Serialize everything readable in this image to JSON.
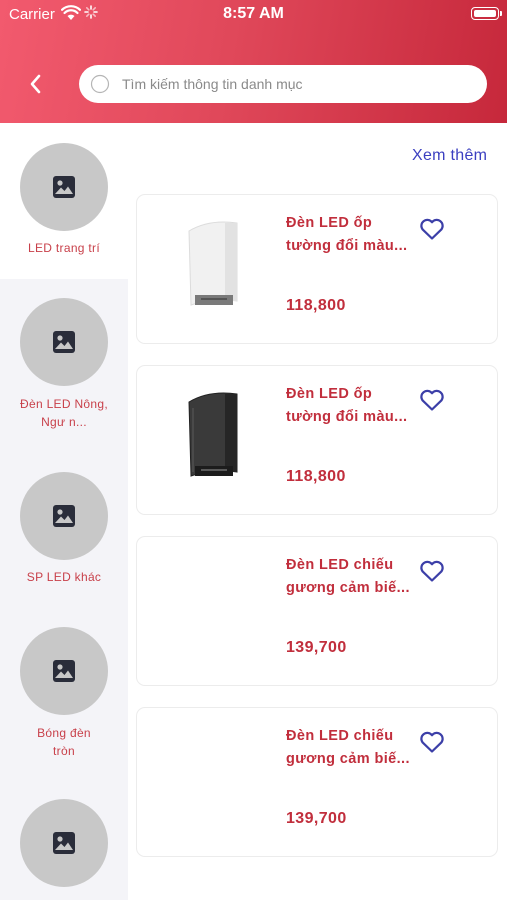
{
  "status_bar": {
    "carrier": "Carrier",
    "time": "8:57 AM"
  },
  "header": {
    "back_icon": "chevron-left-icon",
    "search": {
      "placeholder": "Tìm kiếm thông tin danh mục",
      "value": "",
      "icon": "search-icon"
    }
  },
  "colors": {
    "header_gradient_start": "#f25a6e",
    "header_gradient_end": "#c6283b",
    "accent_red": "#c12e3c",
    "link_blue": "#3b3fc0",
    "sidebar_bg": "#f4f4f8"
  },
  "sidebar": {
    "categories": [
      {
        "label": "LED trang trí",
        "icon": "image-placeholder-icon",
        "active": true
      },
      {
        "label": "Đèn LED Nông, Ngư n...",
        "icon": "image-placeholder-icon",
        "active": false
      },
      {
        "label": "SP LED khác",
        "icon": "image-placeholder-icon",
        "active": false
      },
      {
        "label": "Bóng đèn tròn",
        "icon": "image-placeholder-icon",
        "active": false
      },
      {
        "label": "",
        "icon": "image-placeholder-icon",
        "active": false
      }
    ]
  },
  "main": {
    "see_more": "Xem thêm",
    "products": [
      {
        "name_line1": "Đèn LED ốp",
        "name_line2": "tường đổi màu...",
        "price": "118,800",
        "image": "white-wall-lamp",
        "favorite_icon": "heart-outline-icon"
      },
      {
        "name_line1": "Đèn LED ốp",
        "name_line2": "tường đổi màu...",
        "price": "118,800",
        "image": "black-wall-lamp",
        "favorite_icon": "heart-outline-icon"
      },
      {
        "name_line1": "Đèn LED chiếu",
        "name_line2": "gương cảm biế...",
        "price": "139,700",
        "image": "",
        "favorite_icon": "heart-outline-icon"
      },
      {
        "name_line1": "Đèn LED chiếu",
        "name_line2": "gương cảm biế...",
        "price": "139,700",
        "image": "",
        "favorite_icon": "heart-outline-icon"
      }
    ]
  }
}
